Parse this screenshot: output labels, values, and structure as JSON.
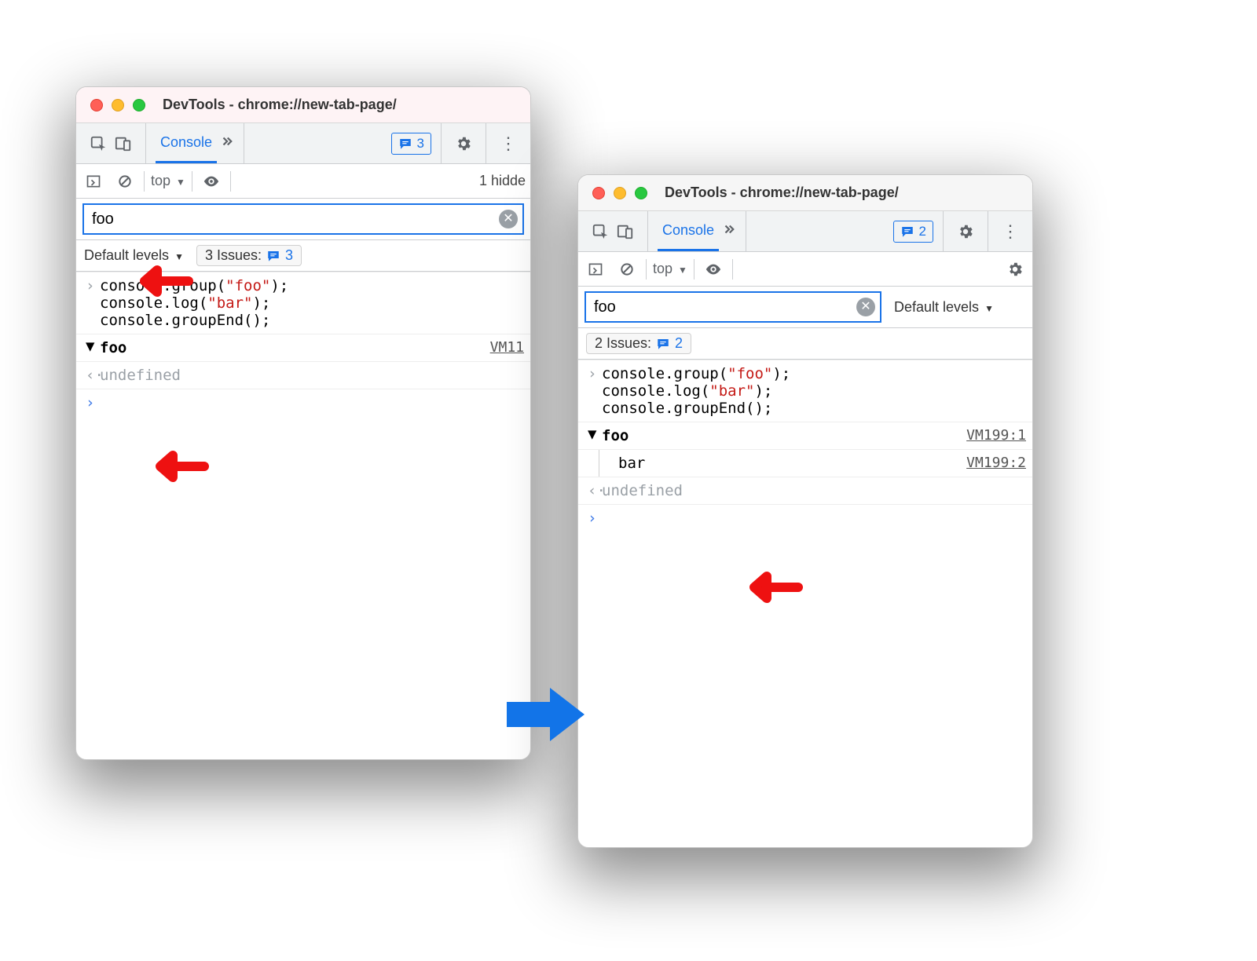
{
  "window_title": "DevTools - chrome://new-tab-page/",
  "tab": {
    "console": "Console"
  },
  "toolbar": {
    "issues_left": "3",
    "issues_right": "2"
  },
  "subbar": {
    "context": "top",
    "hidden_text": "1 hidde"
  },
  "filter": {
    "value": "foo"
  },
  "levels": {
    "label": "Default levels",
    "issues3_prefix": "3 Issues:",
    "issues3_count": "3",
    "issues2_prefix": "2 Issues:",
    "issues2_count": "2"
  },
  "code": {
    "l1a": "console.group(",
    "l1s": "\"foo\"",
    "l1b": ");",
    "l2a": "console.log(",
    "l2s": "\"bar\"",
    "l2b": ");",
    "l3": "console.groupEnd();"
  },
  "group": {
    "label": "foo",
    "child": "bar"
  },
  "source": {
    "left": "VM11",
    "r1": "VM199:1",
    "r2": "VM199:2"
  },
  "undefined": "undefined"
}
